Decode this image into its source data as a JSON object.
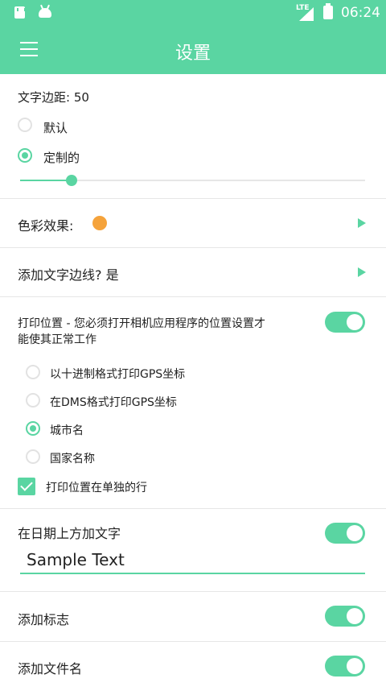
{
  "status_bar": {
    "network": "LTE",
    "time": "06:24"
  },
  "app_bar": {
    "title": "设置",
    "menu_icon": "hamburger-menu-icon"
  },
  "text_margin": {
    "label": "文字边距: 50",
    "options": [
      {
        "label": "默认",
        "selected": false
      },
      {
        "label": "定制的",
        "selected": true
      }
    ],
    "slider_fraction": 0.15
  },
  "color_effect": {
    "label": "色彩效果:",
    "color": "#f5a33b"
  },
  "text_border": {
    "label": "添加文字边线? 是"
  },
  "print_location": {
    "label_line1": "打印位置 - 您必须打开相机应用程序的位置设置才",
    "label_line2": "能使其正常工作",
    "enabled": true,
    "options": [
      {
        "label": "以十进制格式打印GPS坐标",
        "selected": false
      },
      {
        "label": "在DMS格式打印GPS坐标",
        "selected": false
      },
      {
        "label": "城市名",
        "selected": true
      },
      {
        "label": "国家名称",
        "selected": false
      }
    ],
    "separate_line": {
      "label": "打印位置在单独的行",
      "checked": true
    }
  },
  "text_above_date": {
    "label": "在日期上方加文字",
    "enabled": true,
    "value": "Sample Text"
  },
  "add_logo": {
    "label": "添加标志",
    "enabled": true
  },
  "add_filename": {
    "label": "添加文件名",
    "enabled": true
  },
  "colors": {
    "accent": "#5ad5a2",
    "divider": "#e6e6e6"
  }
}
